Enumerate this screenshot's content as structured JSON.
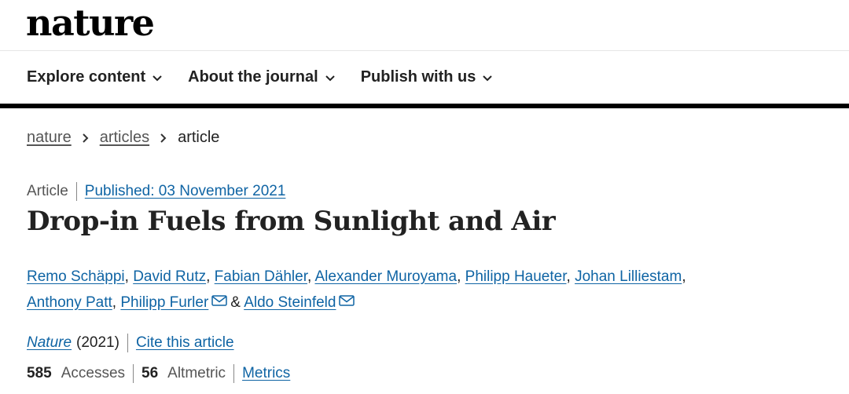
{
  "header": {
    "logo": "nature"
  },
  "nav": {
    "items": [
      {
        "label": "Explore content"
      },
      {
        "label": "About the journal"
      },
      {
        "label": "Publish with us"
      }
    ]
  },
  "breadcrumb": {
    "items": [
      "nature",
      "articles"
    ],
    "current": "article"
  },
  "article": {
    "type": "Article",
    "published": "Published: 03 November 2021",
    "title": "Drop-in Fuels from Sunlight and Air",
    "authors": [
      "Remo Schäppi",
      "David Rutz",
      "Fabian Dähler",
      "Alexander Muroyama",
      "Philipp Haueter",
      "Johan Lilliestam",
      "Anthony Patt",
      "Philipp Furler",
      "Aldo Steinfeld"
    ],
    "journal": "Nature",
    "year": "(2021)",
    "cite_label": "Cite this article",
    "accesses_count": "585",
    "accesses_label": "Accesses",
    "altmetric_count": "56",
    "altmetric_label": "Altmetric",
    "metrics_label": "Metrics"
  },
  "colors": {
    "link": "#0f64a4",
    "text": "#222222",
    "muted": "#555555"
  },
  "icons": {
    "nav_chevron": "chevron-down-icon",
    "breadcrumb_separator": "chevron-right-icon",
    "email": "envelope-icon"
  }
}
